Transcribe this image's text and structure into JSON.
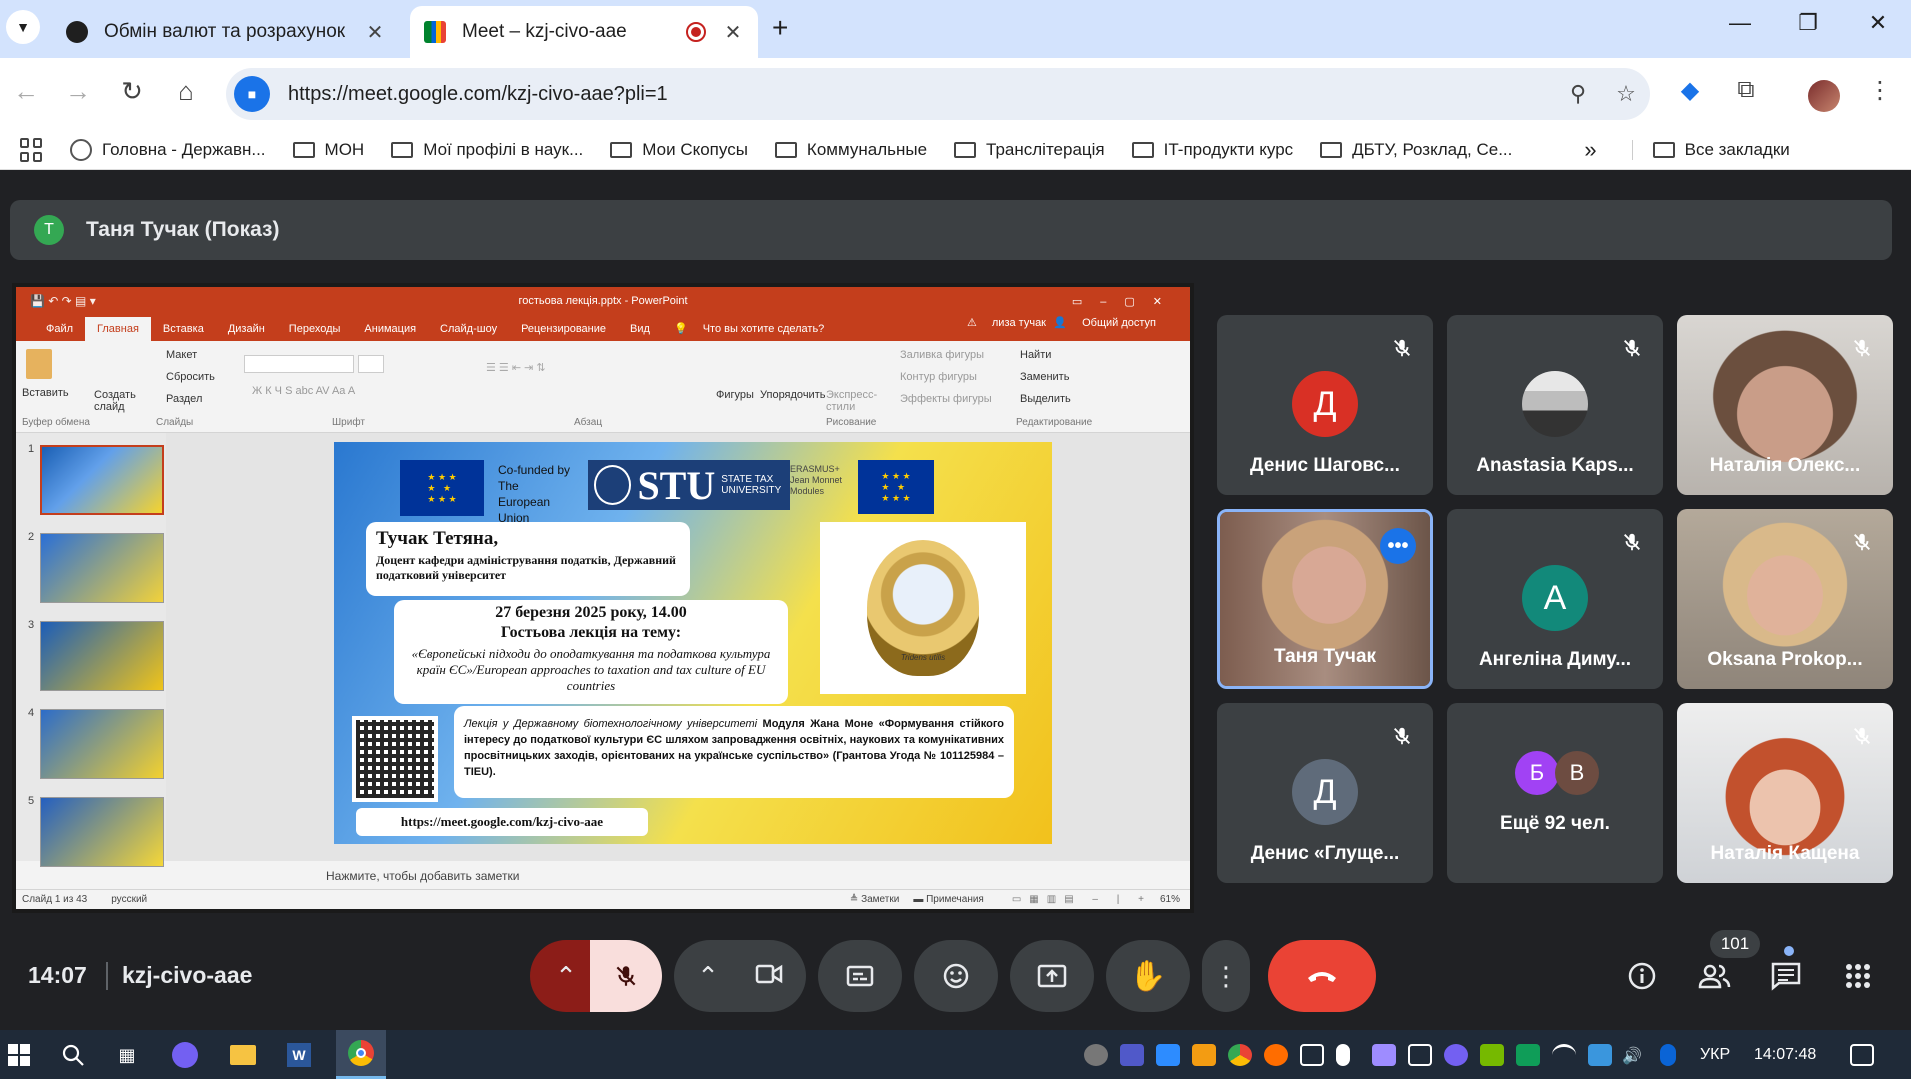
{
  "browser": {
    "tabs": [
      {
        "title": "Обмін валют та розрахунок"
      },
      {
        "title": "Meet – kzj-civo-aae"
      }
    ],
    "url": "https://meet.google.com/kzj-civo-aae?pli=1",
    "bookmarks": [
      {
        "label": "Головна - Державн..."
      },
      {
        "label": "МОН"
      },
      {
        "label": "Мої профілі в наук..."
      },
      {
        "label": "Мои Скопусы"
      },
      {
        "label": "Коммунальные"
      },
      {
        "label": "Транслітерація"
      },
      {
        "label": "IT-продукти курс"
      },
      {
        "label": "ДБТУ, Розклад, Се..."
      }
    ],
    "all_bookmarks": "Все закладки",
    "overflow": "»"
  },
  "presenter": {
    "initial": "T",
    "label": "Таня Тучак (Показ)"
  },
  "powerpoint": {
    "title": "гостьова лекція.pptx - PowerPoint",
    "tabs": [
      "Файл",
      "Главная",
      "Вставка",
      "Дизайн",
      "Переходы",
      "Анимация",
      "Слайд-шоу",
      "Рецензирование",
      "Вид"
    ],
    "tell_me": "Что вы хотите сделать?",
    "user": "лиза тучак",
    "share": "Общий доступ",
    "ribbon": {
      "paste": "Вставить",
      "new_slide": "Создать слайд",
      "layout": "Макет",
      "reset": "Сбросить",
      "section": "Раздел",
      "shapes": "Фигуры",
      "arrange": "Упорядочить",
      "quick_styles": "Экспресс-стили",
      "fill": "Заливка фигуры",
      "outline": "Контур фигуры",
      "effects": "Эффекты фигуры",
      "find": "Найти",
      "replace": "Заменить",
      "select": "Выделить",
      "groups": [
        "Буфер обмена",
        "Слайды",
        "Шрифт",
        "Абзац",
        "Рисование",
        "Редактирование"
      ]
    },
    "thumb_numbers": [
      "1",
      "2",
      "3",
      "4",
      "5"
    ],
    "notes_placeholder": "Нажмите, чтобы добавить заметки",
    "status": {
      "slide": "Слайд 1 из 43",
      "lang": "русский",
      "notes": "Заметки",
      "comments": "Примечания",
      "zoom": "61%"
    },
    "slide": {
      "cofunded": "Co-funded by The European Union",
      "stu_logo": "STU",
      "stu_name": "STATE TAX UNIVERSITY",
      "erasmus": "ERASMUS+ Jean Monnet Modules",
      "name": "Тучак Тетяна,",
      "position": "Доцент кафедри адміністрування податків, Державний податковий університет",
      "date": "27 березня 2025 року, 14.00",
      "lecture_heading": "Гостьова лекція на тему:",
      "topic": "«Європейські підходи до оподаткування та податкова культура країн ЄС»/European approaches to taxation and tax culture of EU countries",
      "module_text_italic": "Лекція у Державному біотехнологічному університеті",
      "module_text_bold": "Модуля Жана Моне «Формування стійкого інтересу до податкової культури ЄС шляхом запровадження освітніх, наукових та комунікативних просвітницьких заходів, орієнтованих на українське суспільство» (Грантова Угода № 101125984 – TIEU).",
      "link": "https://meet.google.com/kzj-civo-aae",
      "emblem_text": "Tridens utilis"
    }
  },
  "participants": [
    {
      "name": "Денис Шаговс...",
      "initial": "Д",
      "color": "#d93025",
      "muted": true
    },
    {
      "name": "Anastasia Kaps...",
      "muted": true
    },
    {
      "name": "Наталія Олекс...",
      "muted": true
    },
    {
      "name": "Таня Тучак",
      "muted": false
    },
    {
      "name": "Ангеліна Диму...",
      "initial": "А",
      "color": "#12897a",
      "muted": true
    },
    {
      "name": "Oksana Prokop...",
      "muted": true
    },
    {
      "name": "Денис «Глуще...",
      "initial": "Д",
      "color": "#5f6b7a",
      "muted": true
    },
    {
      "name": "Ещё 92 чел.",
      "initials": [
        "Б",
        "В"
      ]
    },
    {
      "name": "Наталія Кащена",
      "muted": true
    }
  ],
  "meeting": {
    "time": "14:07",
    "code": "kzj-civo-aae",
    "people_count": "101"
  },
  "taskbar": {
    "lang": "УКР",
    "time": "14:07:48"
  },
  "colors": {
    "end_call": "#ea4335",
    "mic_off_bg": "#f9dedc",
    "mic_chevron_bg": "#8c1d18",
    "ppt": "#c43e1c",
    "meet_bg": "#202124",
    "tile_bg": "#3c4043"
  }
}
